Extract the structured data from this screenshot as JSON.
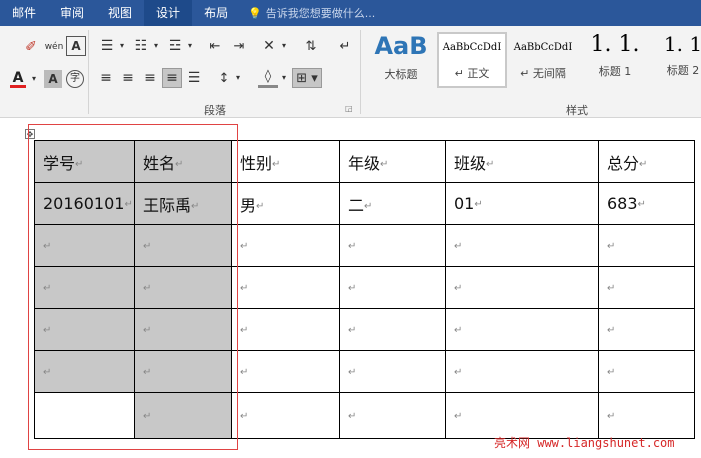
{
  "ribbon_tabs": {
    "mail": "邮件",
    "review": "审阅",
    "view": "视图",
    "design": "设计",
    "layout": "布局",
    "tellme": "告诉我您想要做什么..."
  },
  "ribbon": {
    "paragraph_group": "段落",
    "styles_group": "样式",
    "font_color_glyph": "A",
    "styles": [
      {
        "preview": "AaB",
        "name": "大标题"
      },
      {
        "preview": "AaBbCcDdI",
        "name": "↵ 正文"
      },
      {
        "preview": "AaBbCcDdI",
        "name": "↵ 无间隔"
      },
      {
        "preview": "1. 1.",
        "name": "标题 1"
      },
      {
        "preview": "1. 1",
        "name": "标题 2"
      }
    ]
  },
  "table": {
    "headers": [
      "学号",
      "姓名",
      "性别",
      "年级",
      "班级",
      "总分"
    ],
    "row1": [
      "20160101",
      "王际禹",
      "男",
      "二",
      "01",
      "683"
    ],
    "mark": "↵"
  },
  "watermark": "亮术网 www.liangshunet.com",
  "accent": "#2b579a",
  "selection_color": "#e04343"
}
